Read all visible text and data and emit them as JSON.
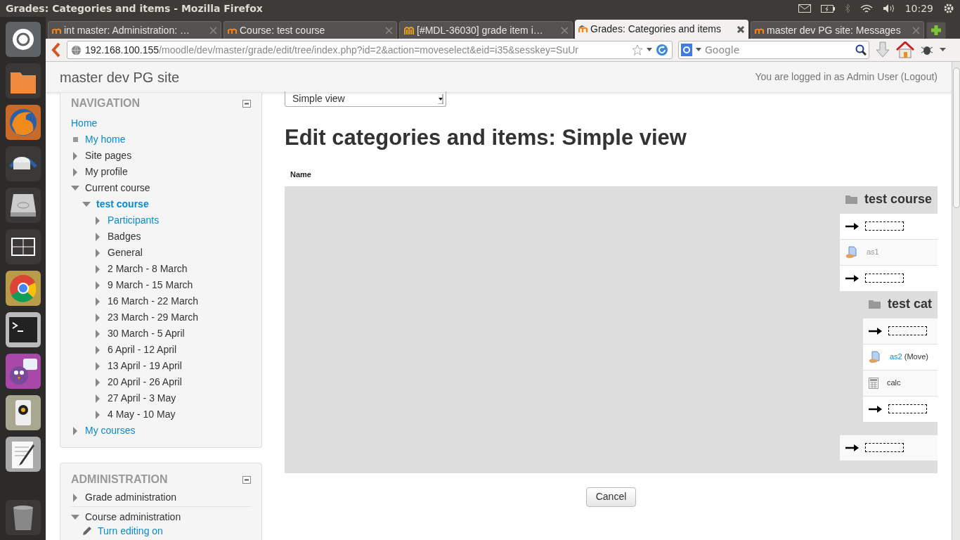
{
  "window": {
    "title": "Grades: Categories and items - Mozilla Firefox"
  },
  "system_tray": {
    "clock": "10:29"
  },
  "tabs": [
    {
      "label": "int master: Administration: …",
      "selected": false
    },
    {
      "label": "Course: test course",
      "selected": false
    },
    {
      "label": "[#MDL-36030] grade item i…",
      "selected": false
    },
    {
      "label": "Grades: Categories and items",
      "selected": true
    },
    {
      "label": "master dev PG site: Messages",
      "selected": false
    }
  ],
  "address_bar": {
    "host": "192.168.100.155",
    "path": "/moodle/dev/master/grade/edit/tree/index.php?id=2&action=moveselect&eid=i35&sesskey=SuUr"
  },
  "search": {
    "placeholder": "Google"
  },
  "site_name": "master dev PG site",
  "login": {
    "text": "You are logged in as Admin User",
    "logout": "(Logout)"
  },
  "navigation": {
    "title": "NAVIGATION",
    "items": [
      {
        "label": "Home",
        "kind": "root",
        "link": true
      },
      {
        "label": "My home",
        "kind": "leaf",
        "link": true
      },
      {
        "label": "Site pages",
        "kind": "node",
        "expanded": false,
        "link": false
      },
      {
        "label": "My profile",
        "kind": "node",
        "expanded": false,
        "link": false
      },
      {
        "label": "Current course",
        "kind": "node",
        "expanded": true,
        "link": false,
        "children": [
          {
            "label": "test course",
            "kind": "node",
            "expanded": true,
            "link": true,
            "current": true,
            "children": [
              {
                "label": "Participants",
                "kind": "node",
                "expanded": false,
                "link": true
              },
              {
                "label": "Badges",
                "kind": "node",
                "expanded": false,
                "link": false
              },
              {
                "label": "General",
                "kind": "node",
                "expanded": false,
                "link": false
              },
              {
                "label": "2 March - 8 March",
                "kind": "node",
                "expanded": false,
                "link": false
              },
              {
                "label": "9 March - 15 March",
                "kind": "node",
                "expanded": false,
                "link": false
              },
              {
                "label": "16 March - 22 March",
                "kind": "node",
                "expanded": false,
                "link": false
              },
              {
                "label": "23 March - 29 March",
                "kind": "node",
                "expanded": false,
                "link": false
              },
              {
                "label": "30 March - 5 April",
                "kind": "node",
                "expanded": false,
                "link": false
              },
              {
                "label": "6 April - 12 April",
                "kind": "node",
                "expanded": false,
                "link": false
              },
              {
                "label": "13 April - 19 April",
                "kind": "node",
                "expanded": false,
                "link": false
              },
              {
                "label": "20 April - 26 April",
                "kind": "node",
                "expanded": false,
                "link": false
              },
              {
                "label": "27 April - 3 May",
                "kind": "node",
                "expanded": false,
                "link": false
              },
              {
                "label": "4 May - 10 May",
                "kind": "node",
                "expanded": false,
                "link": false
              }
            ]
          }
        ]
      },
      {
        "label": "My courses",
        "kind": "node",
        "expanded": false,
        "link": true
      }
    ]
  },
  "administration": {
    "title": "ADMINISTRATION",
    "items": [
      {
        "label": "Grade administration",
        "kind": "node",
        "expanded": false,
        "link": false
      },
      {
        "label": "Course administration",
        "kind": "node",
        "expanded": true,
        "link": false,
        "children": [
          {
            "label": "Turn editing on",
            "kind": "edit",
            "link": true
          }
        ]
      }
    ]
  },
  "view_select": {
    "value": "Simple view"
  },
  "heading": "Edit categories and items: Simple view",
  "table": {
    "columns": [
      "Name"
    ]
  },
  "tree": {
    "kind": "category",
    "name": "test course",
    "children": [
      {
        "kind": "target"
      },
      {
        "kind": "assignment",
        "name": "as1",
        "muted": true
      },
      {
        "kind": "target"
      },
      {
        "kind": "category",
        "name": "test cat",
        "children": [
          {
            "kind": "target"
          },
          {
            "kind": "assignment",
            "name": "as2",
            "muted": false,
            "link": true,
            "note": "(Move)"
          },
          {
            "kind": "calculator",
            "name": "calc",
            "muted": false,
            "link": false
          },
          {
            "kind": "target"
          }
        ]
      },
      {
        "kind": "target"
      }
    ]
  },
  "cancel_button": "Cancel"
}
